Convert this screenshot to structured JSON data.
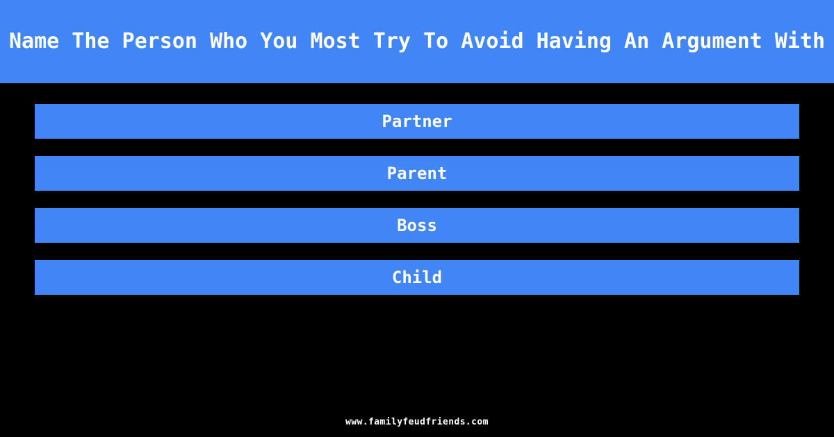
{
  "page": {
    "background_color": "#000000",
    "accent_color": "#4285f4",
    "text_color": "#ffffff"
  },
  "question": {
    "text": "Name The Person Who You Most Try To Avoid Having An Argument With"
  },
  "answers": [
    {
      "label": "Partner"
    },
    {
      "label": "Parent"
    },
    {
      "label": "Boss"
    },
    {
      "label": "Child"
    }
  ],
  "footer": {
    "url": "www.familyfeudfriends.com"
  }
}
